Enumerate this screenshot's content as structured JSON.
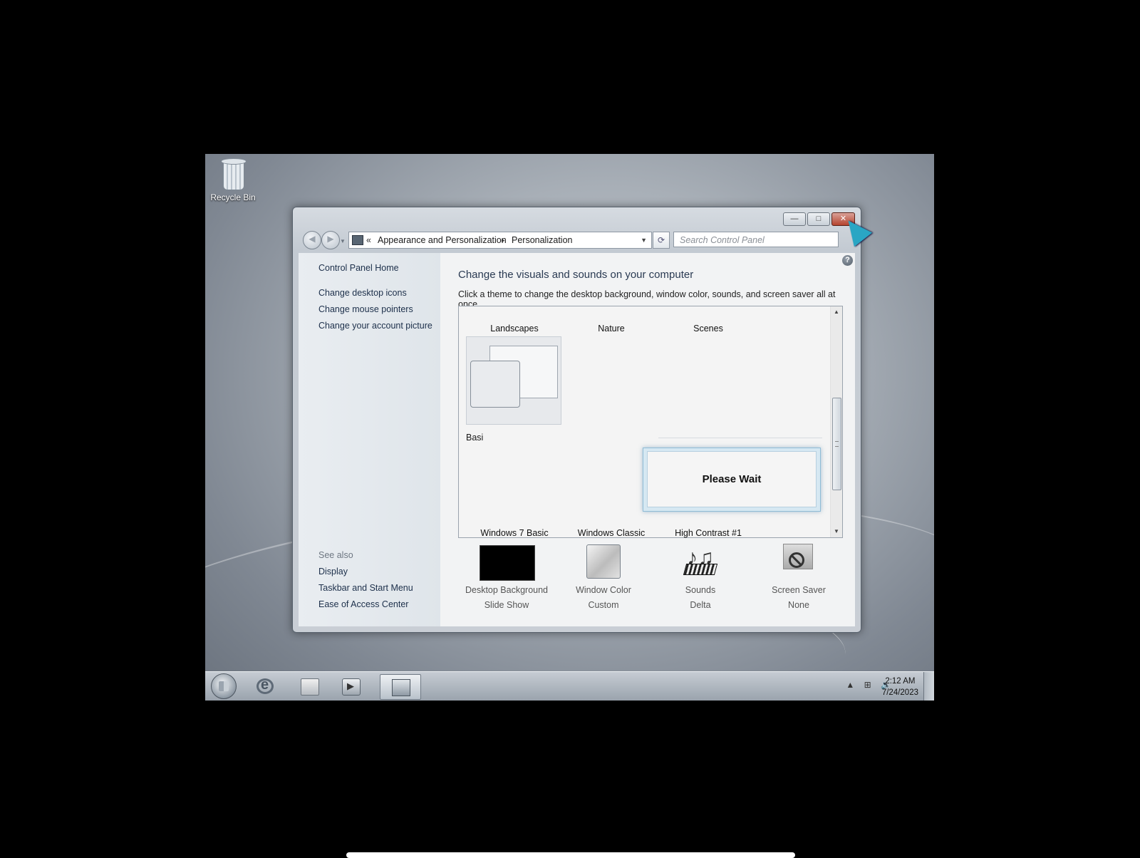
{
  "desktop": {
    "recycle_bin_label": "Recycle Bin"
  },
  "window": {
    "caption_buttons": {
      "minimize": "—",
      "maximize": "□",
      "close": "✕"
    },
    "address": {
      "back_chevron": "«",
      "crumb1": "Appearance and Personalization",
      "separator": "▸",
      "crumb2": "Personalization",
      "dropdown": "▼"
    },
    "refresh_icon": "⟳",
    "search_placeholder": "Search Control Panel",
    "help": "?"
  },
  "left_pane": {
    "home": "Control Panel Home",
    "links": [
      "Change desktop icons",
      "Change mouse pointers",
      "Change your account picture"
    ],
    "see_also_title": "See also",
    "see_also": [
      "Display",
      "Taskbar and Start Menu",
      "Ease of Access Center"
    ]
  },
  "main": {
    "title": "Change the visuals and sounds on your computer",
    "subtitle": "Click a theme to change the desktop background, window color, sounds, and screen saver all at once.",
    "themes_top": [
      "Landscapes",
      "Nature",
      "Scenes"
    ],
    "basic_partial": "Basi",
    "themes_bottom": [
      "Windows 7 Basic",
      "Windows Classic",
      "High Contrast #1"
    ],
    "dialog_message": "Please Wait"
  },
  "bottom_items": [
    {
      "label": "Desktop Background",
      "value": "Slide Show",
      "icon": "desktop-background-icon"
    },
    {
      "label": "Window Color",
      "value": "Custom",
      "icon": "window-color-icon"
    },
    {
      "label": "Sounds",
      "value": "Delta",
      "icon": "sounds-icon"
    },
    {
      "label": "Screen Saver",
      "value": "None",
      "icon": "screen-saver-icon"
    }
  ],
  "taskbar": {
    "pinned": [
      "internet-explorer-icon",
      "windows-explorer-icon",
      "media-player-icon",
      "control-panel-icon"
    ],
    "tray_icons": [
      "show-hidden-icons",
      "network-icon",
      "volume-icon"
    ],
    "tray_glyphs": [
      "▲",
      "⊞",
      "🔊"
    ],
    "time": "2:12 AM",
    "date": "7/24/2023"
  }
}
